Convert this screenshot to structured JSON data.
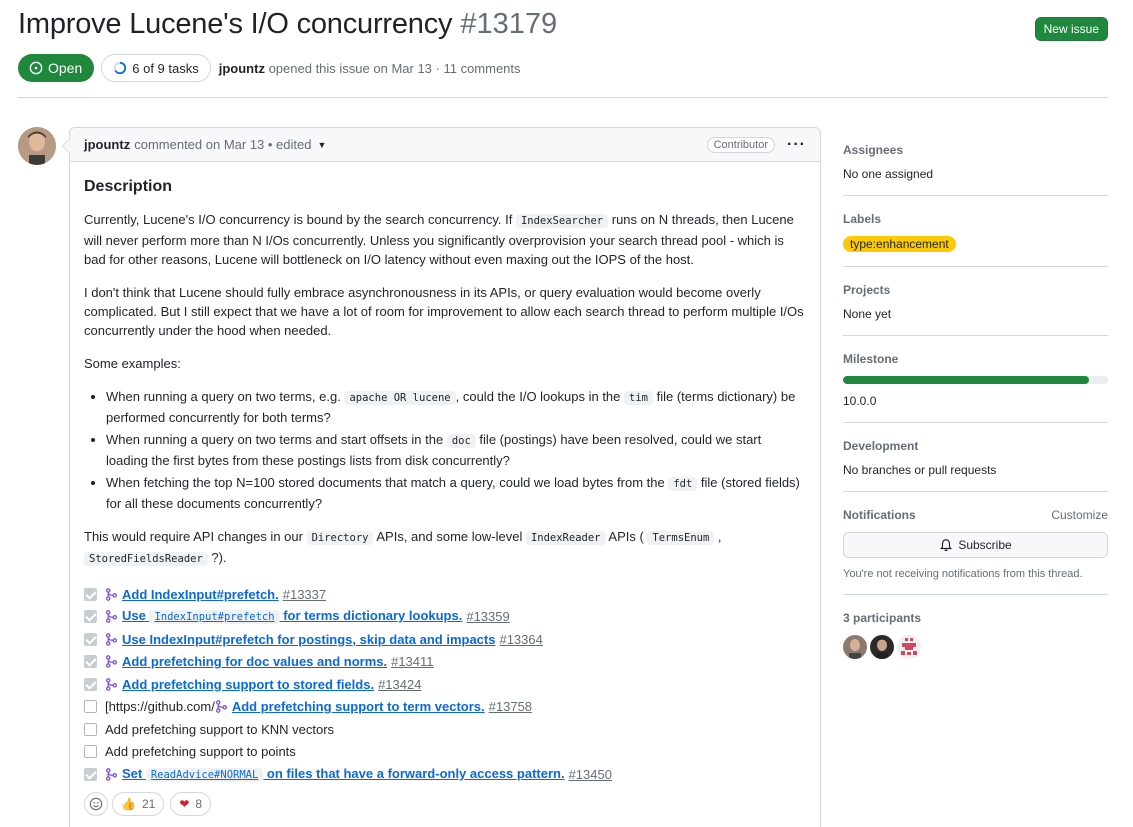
{
  "header": {
    "title": "Improve Lucene's I/O concurrency",
    "number": "#13179",
    "new_issue_label": "New issue",
    "state": "Open",
    "tasks_progress": "6 of 9 tasks",
    "tasks_done_fraction": 0.667,
    "author": "jpountz",
    "meta_suffix": "opened this issue on Mar 13 · 11 comments"
  },
  "comment": {
    "author": "jpountz",
    "meta": "commented on Mar 13 • edited",
    "role": "Contributor",
    "heading": "Description",
    "p1": {
      "a": "Currently, Lucene's I/O concurrency is bound by the search concurrency. If ",
      "code": "IndexSearcher",
      "b": " runs on N threads, then Lucene will never perform more than N I/Os concurrently. Unless you significantly overprovision your search thread pool - which is bad for other reasons, Lucene will bottleneck on I/O latency without even maxing out the IOPS of the host."
    },
    "p2": "I don't think that Lucene should fully embrace asynchronousness in its APIs, or query evaluation would become overly complicated. But I still expect that we have a lot of room for improvement to allow each search thread to perform multiple I/Os concurrently under the hood when needed.",
    "p3": "Some examples:",
    "bullets": [
      {
        "a": "When running a query on two terms, e.g. ",
        "c1": "apache OR lucene",
        "b": ", could the I/O lookups in the ",
        "c2": "tim",
        "d": " file (terms dictionary) be performed concurrently for both terms?"
      },
      {
        "a": "When running a query on two terms and start offsets in the ",
        "c1": "doc",
        "b": " file (postings) have been resolved, could we start loading the first bytes from these postings lists from disk concurrently?"
      },
      {
        "a": "When fetching the top N=100 stored documents that match a query, could we load bytes from the ",
        "c1": "fdt",
        "b": " file (stored fields) for all these documents concurrently?"
      }
    ],
    "p4": {
      "a": "This would require API changes in our ",
      "c1": "Directory",
      "b": " APIs, and some low-level ",
      "c2": "IndexReader",
      "c": " APIs ( ",
      "c3": "TermsEnum",
      "d": " , ",
      "c4": "StoredFieldsReader",
      "e": " ?)."
    },
    "tasks": [
      {
        "text": "Add IndexInput#prefetch.",
        "num": "#13337",
        "checked": true
      },
      {
        "pre": "Use ",
        "code": "IndexInput#prefetch",
        "post": " for terms dictionary lookups.",
        "num": "#13359",
        "checked": true
      },
      {
        "text": "Use IndexInput#prefetch for postings, skip data and impacts",
        "num": "#13364",
        "checked": true
      },
      {
        "text": "Add prefetching for doc values and norms.",
        "num": "#13411",
        "checked": true
      },
      {
        "text": "Add prefetching support to stored fields.",
        "num": "#13424",
        "checked": true
      },
      {
        "prefix": "[https://github.com/",
        "text": "Add prefetching support to term vectors.",
        "num": "#13758",
        "checked": false
      },
      {
        "plain": "Add prefetching support to KNN vectors",
        "checked": false
      },
      {
        "plain": "Add prefetching support to points",
        "checked": false
      },
      {
        "pre": "Set ",
        "code": "ReadAdvice#NORMAL",
        "post": " on files that have a forward-only access pattern.",
        "num": "#13450",
        "checked": true
      }
    ],
    "reactions": [
      {
        "emoji": "👍",
        "count": "21"
      },
      {
        "emoji": "❤",
        "count": "8"
      }
    ]
  },
  "sidebar": {
    "assignees_title": "Assignees",
    "assignees_value": "No one assigned",
    "labels_title": "Labels",
    "label": "type:enhancement",
    "label_color": "#fbca04",
    "projects_title": "Projects",
    "projects_value": "None yet",
    "milestone_title": "Milestone",
    "milestone_value": "10.0.0",
    "milestone_progress": 0.93,
    "development_title": "Development",
    "development_value": "No branches or pull requests",
    "notifications_title": "Notifications",
    "customize": "Customize",
    "subscribe": "Subscribe",
    "notif_note": "You're not receiving notifications from this thread.",
    "participants_title": "3 participants"
  },
  "colors": {
    "green": "#1f883d",
    "link": "#0969da",
    "muted": "#656d76",
    "border": "#d0d7de"
  }
}
